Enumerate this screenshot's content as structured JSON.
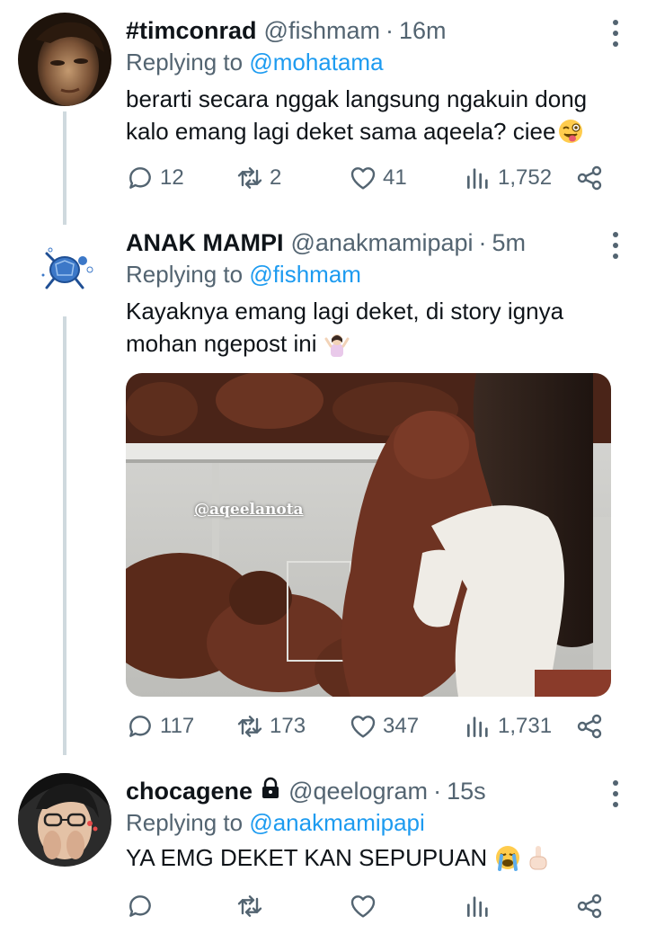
{
  "tweets": [
    {
      "name": "#timconrad",
      "handle": "@fishmam",
      "time": "16m",
      "replying_label": "Replying to",
      "replying_to": "@mohatama",
      "text_line1": "berarti secara nggak langsung ngakuin dong",
      "text_line2": "kalo emang lagi deket sama aqeela? ciee",
      "emoji": "winking-face-with-tongue",
      "replies": "12",
      "retweets": "2",
      "likes": "41",
      "views": "1,752"
    },
    {
      "name": "ANAK MAMPI",
      "handle": "@anakmamipapi",
      "time": "5m",
      "replying_label": "Replying to",
      "replying_to": "@fishmam",
      "text_line1": "Kayaknya emang lagi deket, di story ignya",
      "text_line2": "mohan ngepost ini",
      "emoji": "person-shrugging",
      "media_caption": "@aqeelanota",
      "replies": "117",
      "retweets": "173",
      "likes": "347",
      "views": "1,731"
    },
    {
      "name": "chocagene",
      "handle": "@qeelogram",
      "time": "15s",
      "replying_label": "Replying to",
      "replying_to": "@anakmamipapi",
      "text_line1": "YA EMG DEKET KAN SEPUPUAN",
      "emoji": "loudly-crying-face",
      "emoji2": "index-pointing-up",
      "replies": "",
      "retweets": "",
      "likes": "",
      "views": ""
    }
  ],
  "icons": {
    "reply": "reply-icon",
    "retweet": "retweet-icon",
    "like": "heart-icon",
    "views": "views-icon",
    "share": "share-icon",
    "more": "more-options-icon",
    "lock": "lock-icon"
  },
  "colors": {
    "text": "#0f1419",
    "secondary": "#536471",
    "link": "#1d9bf0",
    "thread_line": "#cfd9de"
  }
}
